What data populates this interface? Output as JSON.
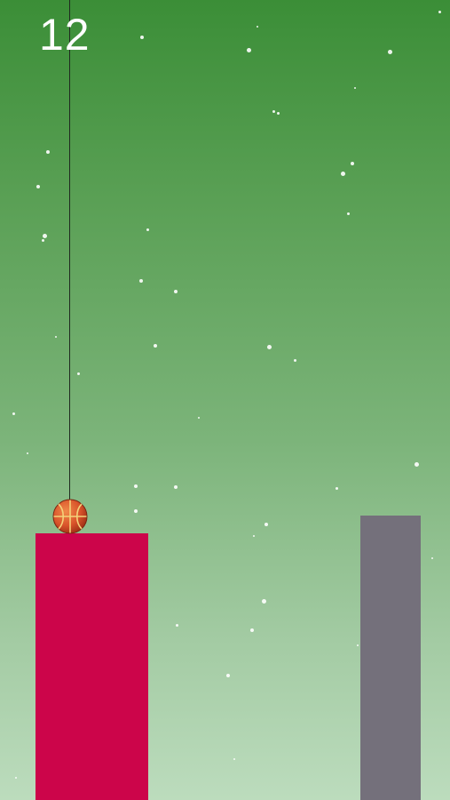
{
  "hud": {
    "score": "12"
  },
  "colors": {
    "current_platform": "#cc054a",
    "target_platform": "#74707b",
    "rope": "#1f2a1f",
    "ball": "#d9532a"
  },
  "icons": {
    "ball": "basketball-icon",
    "snow": "snowflake"
  }
}
